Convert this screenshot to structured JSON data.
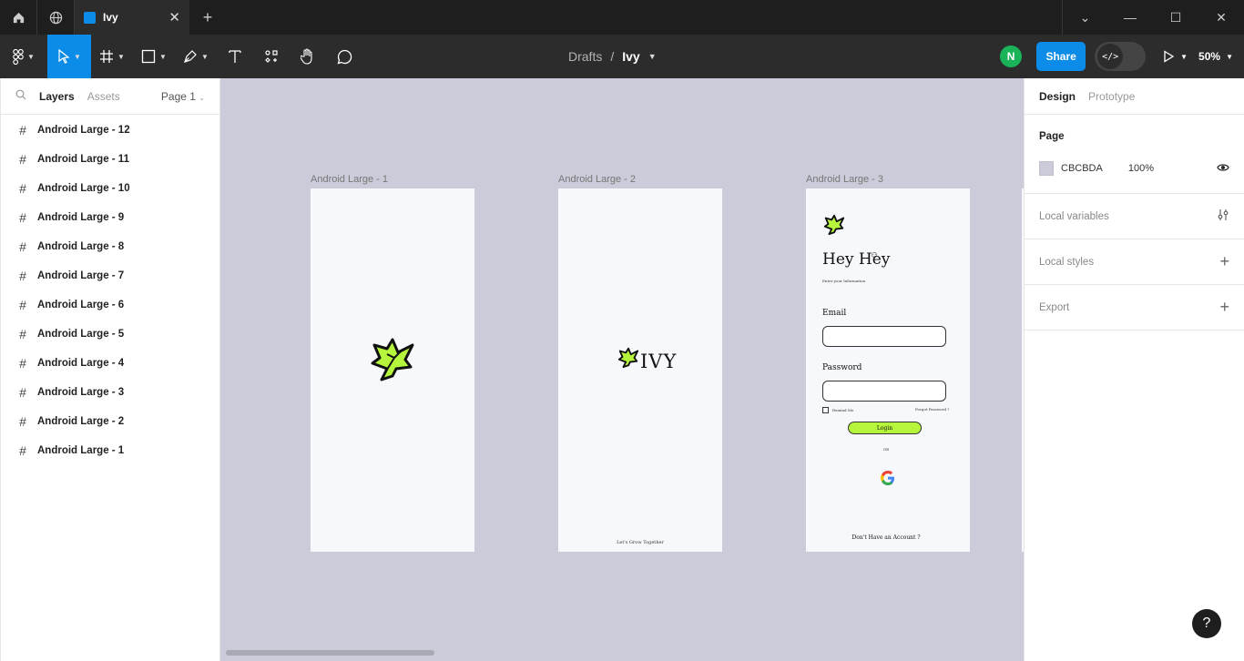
{
  "window": {
    "tab_title": "Ivy",
    "tab_close": "✕",
    "new_tab": "+",
    "controls": {
      "chevron": "⌄",
      "minimize": "—",
      "maximize": "☐",
      "close": "✕"
    }
  },
  "toolbar": {
    "breadcrumb_parent": "Drafts",
    "breadcrumb_sep": "/",
    "file_name": "Ivy",
    "avatar_initial": "N",
    "share_label": "Share",
    "zoom_label": "50%",
    "dev_mode_symbol": "</>"
  },
  "left_panel": {
    "tab_layers": "Layers",
    "tab_assets": "Assets",
    "page_selector": "Page 1",
    "layers": [
      {
        "label": "Android Large - 12"
      },
      {
        "label": "Android Large - 11"
      },
      {
        "label": "Android Large - 10"
      },
      {
        "label": "Android Large - 9"
      },
      {
        "label": "Android Large - 8"
      },
      {
        "label": "Android Large - 7"
      },
      {
        "label": "Android Large - 6"
      },
      {
        "label": "Android Large - 5"
      },
      {
        "label": "Android Large - 4"
      },
      {
        "label": "Android Large - 3"
      },
      {
        "label": "Android Large - 2"
      },
      {
        "label": "Android Large - 1"
      }
    ]
  },
  "canvas": {
    "background": "#cbcbda",
    "frames": [
      {
        "label": "Android Large - 1"
      },
      {
        "label": "Android Large - 2",
        "logo_text": "IVY",
        "footer": "Let's Grow Together"
      },
      {
        "label": "Android Large - 3",
        "greeting": "Hey Hey",
        "subtitle": "Enter your Information",
        "email_label": "Email",
        "password_label": "Password",
        "remember": "Remind Me",
        "forgot": "Forgot Password ?",
        "login_button": "Login",
        "or_text": "OR",
        "signup_prompt": "Don't Have an Account ?"
      }
    ],
    "leaf_color": "#b5f53b"
  },
  "right_panel": {
    "tab_design": "Design",
    "tab_prototype": "Prototype",
    "page_section_title": "Page",
    "page_color": "CBCBDA",
    "page_opacity": "100%",
    "local_variables": "Local variables",
    "local_styles": "Local styles",
    "export": "Export"
  },
  "help_label": "?"
}
